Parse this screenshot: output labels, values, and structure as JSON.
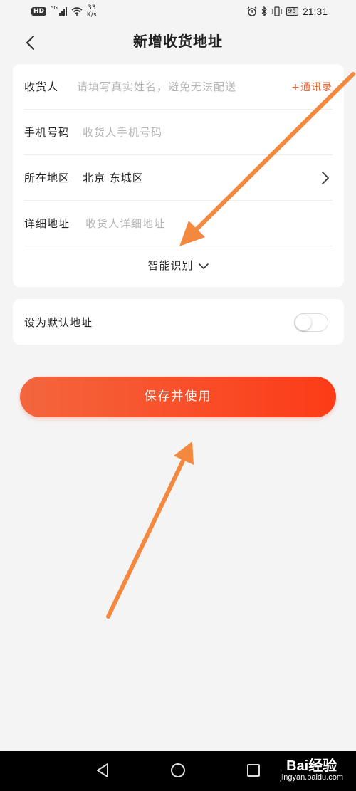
{
  "status_bar": {
    "hd": "HD",
    "network": "5G",
    "speed_value": "33",
    "speed_unit": "K/s",
    "battery": "95",
    "time": "21:31"
  },
  "header": {
    "title": "新增收货地址"
  },
  "form": {
    "recipient_label": "收货人",
    "recipient_placeholder": "请填写真实姓名，避免无法配送",
    "contacts_link": "+通讯录",
    "phone_label": "手机号码",
    "phone_placeholder": "收货人手机号码",
    "region_label": "所在地区",
    "region_value": "北京 东城区",
    "detail_label": "详细地址",
    "detail_placeholder": "收货人详细地址",
    "smart_recognition": "智能识别"
  },
  "default_address": {
    "label": "设为默认地址",
    "enabled": false
  },
  "actions": {
    "save_label": "保存并使用"
  },
  "watermark": {
    "brand": "Bai经验",
    "site": "jingyan.baidu.com"
  },
  "colors": {
    "accent": "#f0622b",
    "button_start": "#f4663e",
    "button_end": "#fc3b17",
    "annotation_arrow": "#f3893e"
  },
  "icons": [
    "back-icon",
    "chevron-right-icon",
    "chevron-down-icon",
    "nav-back-icon",
    "nav-home-icon",
    "nav-recents-icon"
  ]
}
